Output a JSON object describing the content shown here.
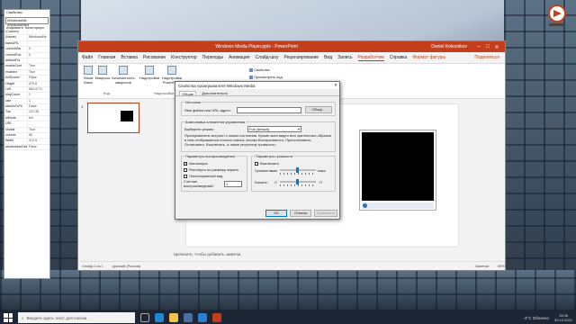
{
  "properties_panel": {
    "title": "Свойства",
    "object_selector": "WindowsMe WindowsMed",
    "tabs": [
      "Алфавитн",
      "Категориро"
    ],
    "rows": [
      [
        "(Custom)",
        ""
      ],
      [
        "(Name)",
        "WindowsMe"
      ],
      [
        "baseURL",
        ""
      ],
      [
        "currentMar",
        "0"
      ],
      [
        "currentPos",
        "0"
      ],
      [
        "defaultFra",
        ""
      ],
      [
        "enableCont",
        "True"
      ],
      [
        "enabled",
        "True"
      ],
      [
        "fullScreen",
        "False"
      ],
      [
        "Height",
        "379.5"
      ],
      [
        "Left",
        "584.0771"
      ],
      [
        "playCount",
        "1"
      ],
      [
        "rate",
        "1"
      ],
      [
        "stretchToFit",
        "False"
      ],
      [
        "Top",
        "121.35"
      ],
      [
        "uiMode",
        "full"
      ],
      [
        "URL",
        ""
      ],
      [
        "Visible",
        "True"
      ],
      [
        "volume",
        "50"
      ],
      [
        "Width",
        "372.5"
      ],
      [
        "windowlessVideo",
        "False"
      ]
    ]
  },
  "ppt": {
    "title": "Windows Media Player.pptx - PowerPoint",
    "user": "Daniel Kolesnikov",
    "ribbon_tabs": [
      "Файл",
      "Главная",
      "Вставка",
      "Рисование",
      "Конструктор",
      "Переходы",
      "Анимация",
      "Слайд-шоу",
      "Рецензирование",
      "Вид",
      "Запись",
      "Разработчик",
      "Справка",
      "Формат фигуры",
      "Поделиться"
    ],
    "active_tab": "Разработчик",
    "groups": {
      "code": {
        "label": "Код",
        "items": [
          "Visual Basic",
          "Макросы",
          "Безопасность макросов"
        ]
      },
      "addins": {
        "label": "Надстройки",
        "items": [
          "Надстройки",
          "Надстройки PowerPoint"
        ]
      },
      "controls": {
        "label": "Элементы управления",
        "items": [
          "Свойства",
          "Просмотреть код"
        ]
      }
    },
    "slide_number": "1",
    "notes_placeholder": "Щелкните, чтобы добавить заметки",
    "status": {
      "slide_info": "Слайд 1 из 1",
      "language": "русский (Россия)",
      "notes": "Заметки",
      "zoom": "55%"
    }
  },
  "dialog": {
    "title": "Свойства проигрывателя Windows Media",
    "tabs": [
      "Общие",
      "Дополнительно"
    ],
    "source_group": "Источник",
    "file_label": "Имя файла или URL-адрес:",
    "file_value": "",
    "browse": "Обзор...",
    "controls_group": "Компоновка элементов управления",
    "mode_label": "Выберите режим:",
    "mode_value": "Full (default)",
    "mode_description": "Проигрыватель встроен с окном состояния. Кроме окна видео или зрительных образов в нем отображаются полоса поиска, кнопки Воспроизвести, Приостановить, Остановить, Выключить, а также регулятор громкости.",
    "playback_group": "Параметры воспроизведения",
    "autostart": "Автозапуск",
    "stretch": "Растянуть по размеру экрана",
    "fullscreen": "Полноэкранный вид",
    "counter_label": "Счетчик воспроизведений:",
    "counter_value": "1",
    "volume_group": "Параметры громкости",
    "mute": "Выключить",
    "volume_label": "Громкость:",
    "vol_min": "мин",
    "vol_max": "макс",
    "balance_label": "Баланс:",
    "bal_left": "Л",
    "bal_right": "П",
    "ok": "ОК",
    "cancel": "Отмена",
    "apply": "Применить"
  },
  "taskbar": {
    "search_placeholder": "Введите здесь текст для поиска",
    "weather": "-4°C Облачно",
    "time": "15:06",
    "date": "30.12.2021"
  },
  "colors": {
    "ppt_accent": "#c43e1c",
    "taskbar": "#1d2635"
  },
  "icons": [
    "windows-start-icon",
    "search-icon",
    "task-view-icon",
    "edge-icon",
    "explorer-icon",
    "store-icon",
    "mail-icon",
    "powerpoint-icon"
  ]
}
